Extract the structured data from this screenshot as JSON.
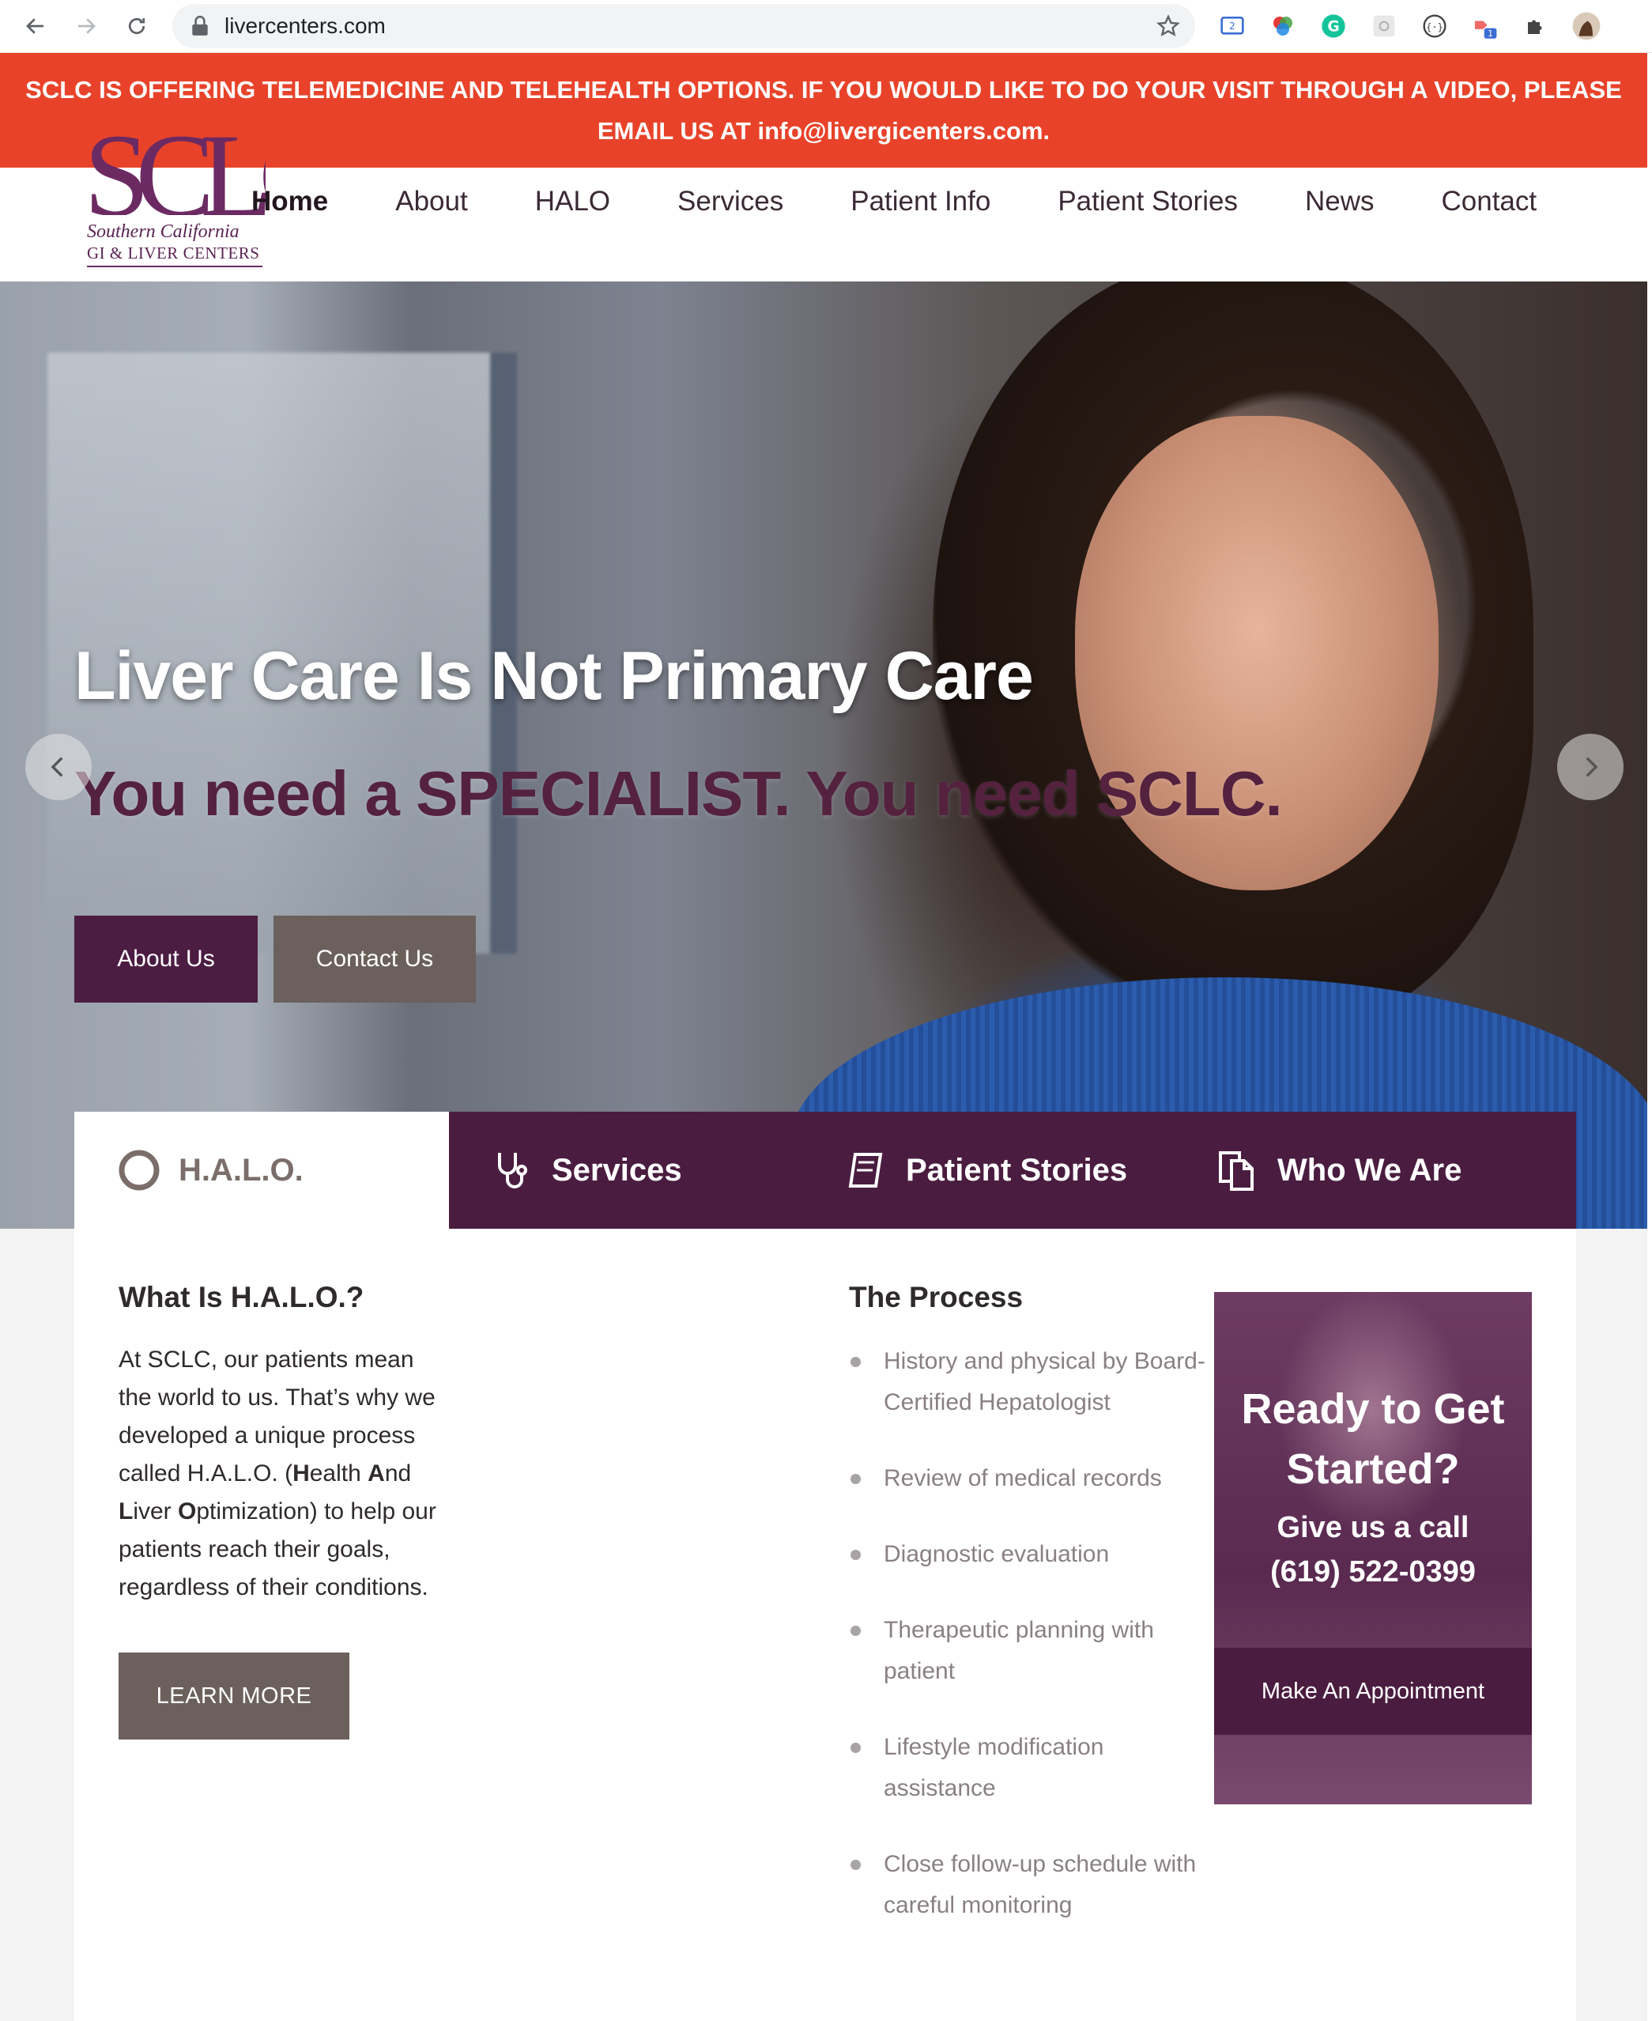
{
  "browser": {
    "url": "livercenters.com",
    "extension_badge": "1",
    "extension_badge2": "2"
  },
  "banner": {
    "text": "SCLC IS OFFERING TELEMEDICINE AND TELEHEALTH OPTIONS. IF YOU WOULD LIKE TO DO YOUR VISIT THROUGH A VIDEO, PLEASE EMAIL US AT info@livergicenters.com.",
    "color": "#e8432a"
  },
  "logo": {
    "mark": "SCLC",
    "line1": "Southern California",
    "line2": "GI & LIVER CENTERS"
  },
  "nav": {
    "items": [
      "Home",
      "About",
      "HALO",
      "Services",
      "Patient Info",
      "Patient Stories",
      "News",
      "Contact"
    ],
    "active": "Home"
  },
  "hero": {
    "title": "Liver Care Is Not Primary Care",
    "subtitle": "You need a SPECIALIST. You need SCLC.",
    "buttons": [
      "About Us",
      "Contact Us"
    ]
  },
  "tabs": [
    {
      "label": "H.A.L.O.",
      "icon": "circle-icon",
      "active": true
    },
    {
      "label": "Services",
      "icon": "stethoscope-icon",
      "active": false
    },
    {
      "label": "Patient Stories",
      "icon": "book-icon",
      "active": false
    },
    {
      "label": "Who We Are",
      "icon": "documents-icon",
      "active": false
    }
  ],
  "halo": {
    "heading": "What Is H.A.L.O.?",
    "text_before": "At SCLC, our patients mean the world to us. That’s why we developed a unique process called H.A.L.O. (",
    "h_bold": "H",
    "h_rest": "ealth ",
    "a_bold": "A",
    "a_rest": "nd ",
    "l_bold": "L",
    "l_rest": "iver ",
    "o_bold": "O",
    "o_rest": "ptimization) to help our patients reach their goals, regardless of their conditions.",
    "button": "LEARN MORE"
  },
  "process": {
    "heading": "The Process",
    "items": [
      "History and physical by Board-Certified Hepatologist",
      "Review of medical records",
      "Diagnostic evaluation",
      "Therapeutic planning with patient",
      "Lifestyle modification assistance",
      "Close follow-up schedule with careful monitoring"
    ]
  },
  "cta": {
    "heading": "Ready to Get Started?",
    "call_label": "Give us a call",
    "phone": "(619) 522-0399",
    "button": "Make An Appointment"
  },
  "colors": {
    "brand_purple": "#4a1d40",
    "button_gray": "#6b605c",
    "alert_red": "#e8432a"
  }
}
